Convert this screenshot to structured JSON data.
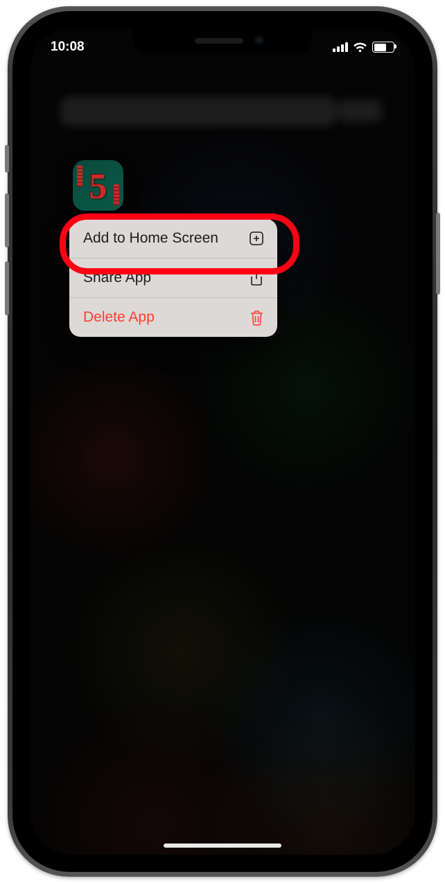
{
  "status_bar": {
    "time": "10:08"
  },
  "menu": {
    "items": [
      {
        "label": "Add to Home Screen",
        "icon": "plus-square-icon",
        "destructive": false
      },
      {
        "label": "Share App",
        "icon": "share-icon",
        "destructive": false
      },
      {
        "label": "Delete App",
        "icon": "trash-icon",
        "destructive": true
      }
    ]
  },
  "highlighted_item_index": 0
}
